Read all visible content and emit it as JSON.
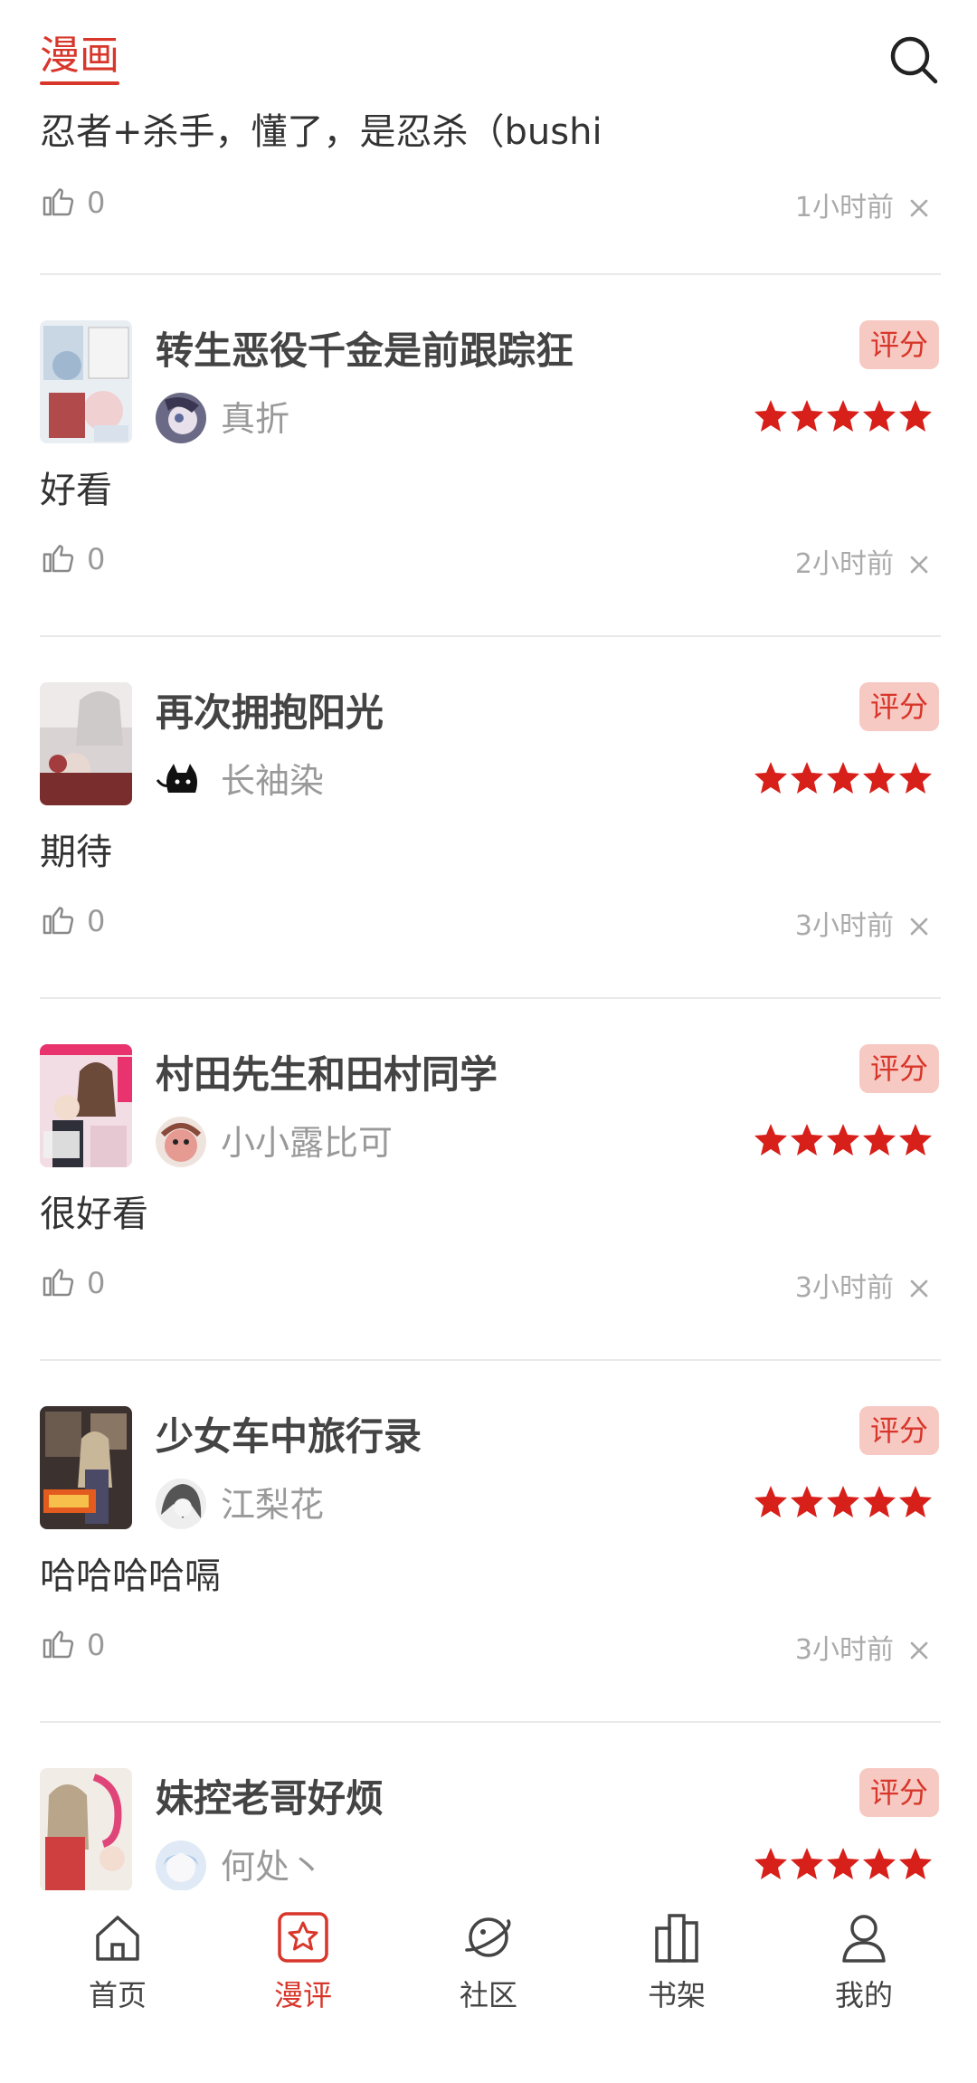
{
  "header": {
    "tab_label": "漫画",
    "search_icon": "search-icon"
  },
  "partial_review": {
    "comment": "忍者+杀手，懂了，是忍杀（bushi",
    "likes": "0",
    "time": "1小时前"
  },
  "reviews": [
    {
      "title": "转生恶役千金是前跟踪狂",
      "user": "真折",
      "badge": "评分",
      "comment": "好看",
      "likes": "0",
      "time": "2小时前",
      "rating": 5
    },
    {
      "title": "再次拥抱阳光",
      "user": "长袖染",
      "badge": "评分",
      "comment": "期待",
      "likes": "0",
      "time": "3小时前",
      "rating": 5
    },
    {
      "title": "村田先生和田村同学",
      "user": "小小露比可",
      "badge": "评分",
      "comment": "很好看",
      "likes": "0",
      "time": "3小时前",
      "rating": 5
    },
    {
      "title": "少女车中旅行录",
      "user": "江梨花",
      "badge": "评分",
      "comment": "哈哈哈哈嗝",
      "likes": "0",
      "time": "3小时前",
      "rating": 5
    },
    {
      "title": "妹控老哥好烦",
      "user": "何处丶",
      "badge": "评分",
      "comment": "",
      "likes": "",
      "time": "",
      "rating": 5
    }
  ],
  "bottom_nav": [
    {
      "label": "首页",
      "icon": "home-icon"
    },
    {
      "label": "漫评",
      "icon": "star-review-icon",
      "active": true
    },
    {
      "label": "社区",
      "icon": "planet-icon"
    },
    {
      "label": "书架",
      "icon": "bookshelf-icon"
    },
    {
      "label": "我的",
      "icon": "user-icon"
    }
  ],
  "colors": {
    "accent": "#d8362a",
    "badge_bg": "#f7c9c3",
    "muted": "#999999"
  }
}
